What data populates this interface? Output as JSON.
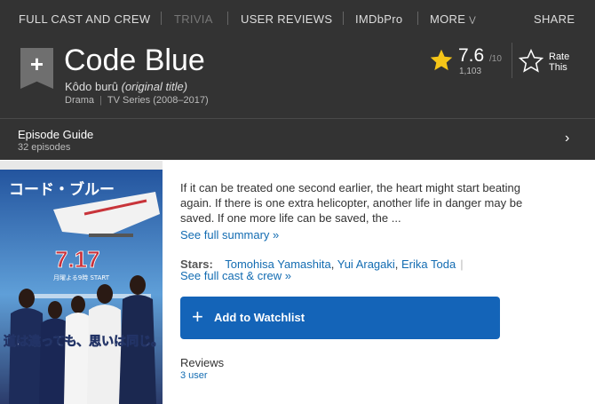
{
  "topnav": {
    "items": [
      "FULL CAST AND CREW",
      "TRIVIA",
      "USER REVIEWS",
      "IMDbPro",
      "MORE"
    ],
    "share": "SHARE",
    "more_icon": "double-chevron-down-icon"
  },
  "title_block": {
    "watchlist_icon": "plus-icon",
    "title": "Code Blue",
    "original_title_name": "Kôdo burû",
    "original_title_suffix": "(original title)",
    "genre": "Drama",
    "type_years": "TV Series (2008–2017)"
  },
  "rating": {
    "value": "7.6",
    "max": "/10",
    "votes": "1,103",
    "star_color": "#f5c518",
    "rate_line1": "Rate",
    "rate_line2": "This"
  },
  "episode_guide": {
    "title": "Episode Guide",
    "count": "32 episodes",
    "chevron": "›"
  },
  "poster": {
    "title_text": "コード・ブルー",
    "date_text": "7.17",
    "tagline": "道は違っても、思いは同じ。",
    "subline": "月曜よる9時 START"
  },
  "summary": {
    "text": "If it can be treated one second earlier, the heart might start beating again. If there is one extra helicopter, another life in danger may be saved. If one more life can be saved, the ...",
    "see_full": "See full summary »"
  },
  "stars": {
    "label": "Stars:",
    "names": [
      "Tomohisa Yamashita",
      "Yui Aragaki",
      "Erika Toda"
    ],
    "see_cast": "See full cast & crew »"
  },
  "watchlist": {
    "plus": "+",
    "label": "Add to Watchlist",
    "color": "#1464b8"
  },
  "reviews": {
    "label": "Reviews",
    "count": "3 user"
  }
}
